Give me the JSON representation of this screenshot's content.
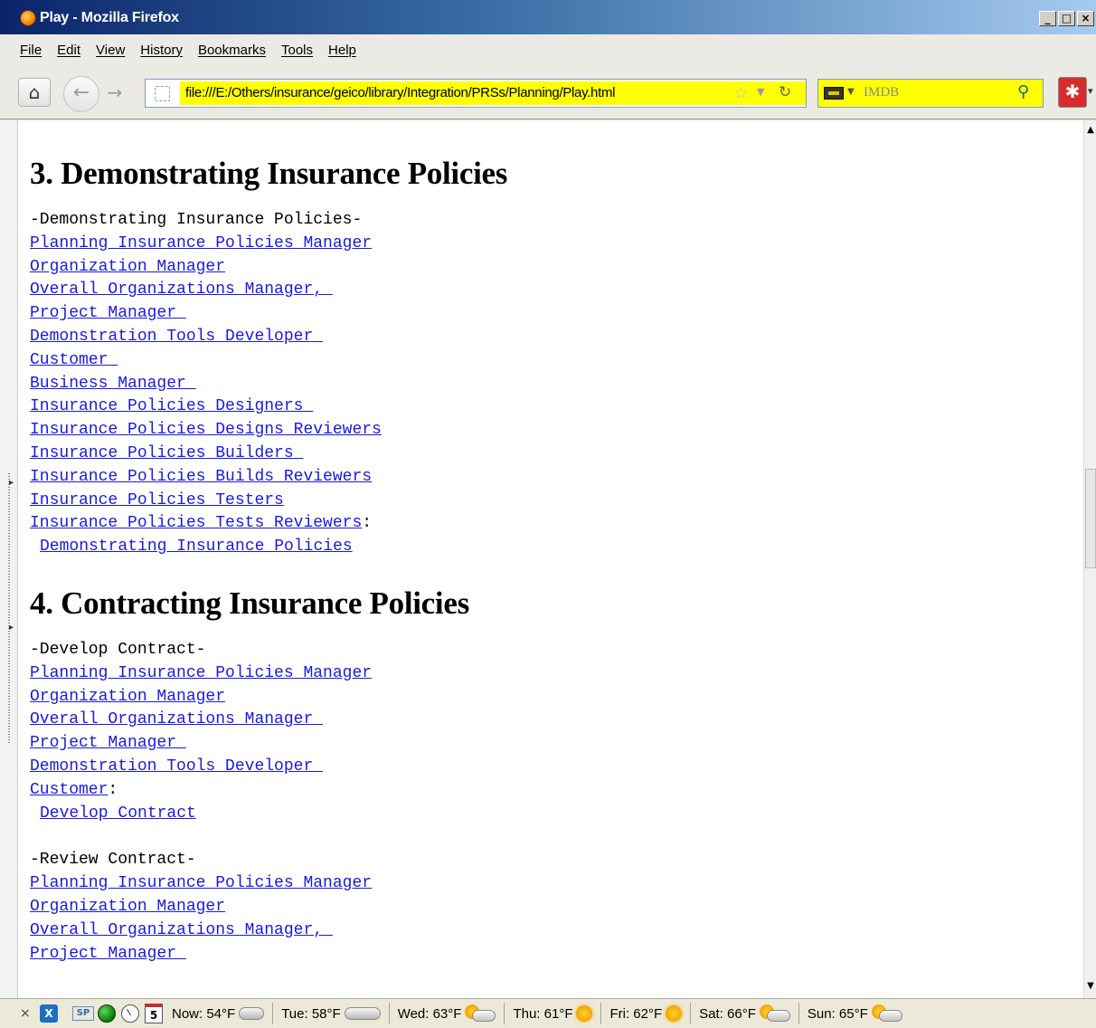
{
  "window": {
    "title": "Play - Mozilla Firefox",
    "controls": [
      "_",
      "□",
      "×"
    ]
  },
  "menu": {
    "items": [
      "File",
      "Edit",
      "View",
      "History",
      "Bookmarks",
      "Tools",
      "Help"
    ]
  },
  "nav": {
    "url": "file:///E:/Others/insurance/geico/library/Integration/PRSs/Planning/Play.html",
    "search_placeholder": "IMDB",
    "accent_url_bg": "#ffff00"
  },
  "content": {
    "section3": {
      "heading": "3. Demonstrating Insurance Policies",
      "intro": "-Demonstrating Insurance Policies-",
      "links": [
        "Planning Insurance Policies Manager",
        "Organization Manager",
        "Overall Organizations Manager, ",
        "Project Manager ",
        "Demonstration Tools Developer ",
        "Customer ",
        "Business Manager ",
        "Insurance Policies Designers ",
        "Insurance Policies Designs Reviewers",
        "Insurance Policies Builders ",
        "Insurance Policies Builds Reviewers",
        "Insurance Policies Testers",
        "Insurance Policies Tests Reviewers"
      ],
      "colon": ":",
      "action": "Demonstrating Insurance Policies"
    },
    "section4": {
      "heading": "4. Contracting Insurance Policies",
      "develop": {
        "intro": "-Develop Contract-",
        "links": [
          "Planning Insurance Policies Manager",
          "Organization Manager",
          "Overall Organizations Manager ",
          "Project Manager ",
          "Demonstration Tools Developer ",
          "Customer"
        ],
        "colon": ":",
        "action": "Develop Contract"
      },
      "review": {
        "intro": "-Review Contract-",
        "links": [
          "Planning Insurance Policies Manager",
          "Organization Manager",
          "Overall Organizations Manager, ",
          "Project Manager "
        ]
      }
    }
  },
  "status": {
    "close": "×",
    "xmarks": "X",
    "sp": "SP",
    "calendar_day": "5",
    "weather": [
      {
        "label": "Now: 54°F",
        "icon": "cloud-icon"
      },
      {
        "label": "Tue: 58°F",
        "icon": "cloud-icon"
      },
      {
        "label": "Wed: 63°F",
        "icon": "partly-sunny-icon"
      },
      {
        "label": "Thu: 61°F",
        "icon": "sun-icon"
      },
      {
        "label": "Fri: 62°F",
        "icon": "sun-icon"
      },
      {
        "label": "Sat: 66°F",
        "icon": "partly-sunny-icon"
      },
      {
        "label": "Sun: 65°F",
        "icon": "partly-sunny-icon"
      }
    ]
  }
}
